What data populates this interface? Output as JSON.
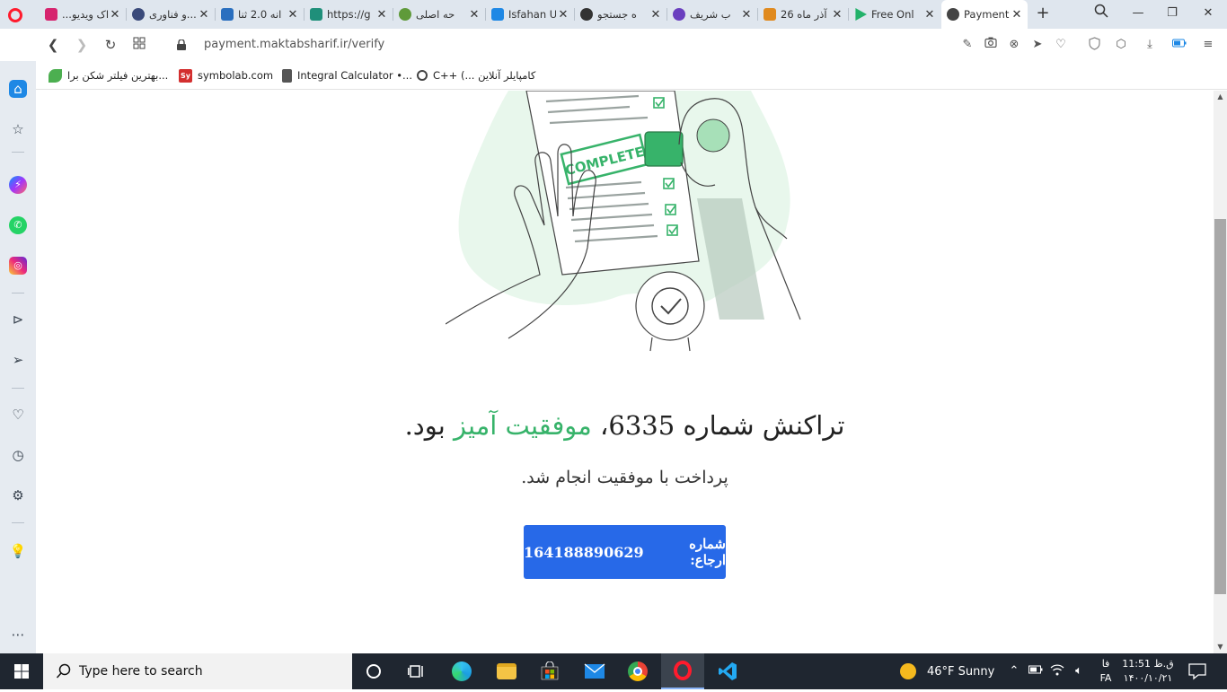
{
  "browser": {
    "tabs": [
      {
        "title": "...اک ویدیو",
        "favicon": "instagram-like-icon",
        "color": "#d6246e"
      },
      {
        "title": "و فناوری...",
        "favicon": "globe-icon",
        "color": "#3a4a7a"
      },
      {
        "title": "انه 2.0 ثنا",
        "favicon": "chart-icon",
        "color": "#2a6fbf"
      },
      {
        "title": "https://g",
        "favicon": "shield-icon",
        "color": "#1f8f7a"
      },
      {
        "title": "حه اصلی",
        "favicon": "flower-icon",
        "color": "#5f9a3a"
      },
      {
        "title": "Isfahan U",
        "favicon": "envelope-icon",
        "color": "#1e88e5"
      },
      {
        "title": "ه جستجو",
        "favicon": "globe-icon",
        "color": "#333333"
      },
      {
        "title": "ب شریف",
        "favicon": "pen-icon",
        "color": "#6a3fbf"
      },
      {
        "title": "26 آذر ماه",
        "favicon": "m-icon",
        "color": "#e08a1e"
      },
      {
        "title": "Free Onl",
        "favicon": "play-icon",
        "color": "#23b26a"
      },
      {
        "title": "Payment",
        "favicon": "globe-icon",
        "color": "#333333"
      }
    ],
    "new_tab": "+",
    "url": "payment.maktabsharif.ir/verify",
    "bookmarks": [
      {
        "label": "بهترین فیلتر شکن برا...",
        "icon": "leaf-icon",
        "color": "#4caf50"
      },
      {
        "label": "symbolab.com",
        "icon": "symbolab-icon",
        "color": "#d32f2f",
        "badge": "Sy"
      },
      {
        "label": "Integral Calculator •...",
        "icon": "file-icon",
        "color": "#555555"
      },
      {
        "label": "C++ (... کامپایلر آنلاین",
        "icon": "cpp-icon",
        "color": "#444444"
      }
    ]
  },
  "page": {
    "headline_pre": "تراکنش شماره 6335، ",
    "headline_success": "موفقیت آمیز",
    "headline_post": " بود.",
    "subtitle": "پرداخت با موفقیت انجام شد.",
    "reference_label": "شماره ارجاع:",
    "reference_number": "164188890629",
    "illustration_stamp_text": "COMPLETE",
    "accent": "#37b36a",
    "button_color": "#2769e8"
  },
  "taskbar": {
    "search_placeholder": "Type here to search",
    "weather": "46°F  Sunny",
    "language_top": "فا",
    "language_bottom": "FA",
    "time": "11:51 ق.ظ",
    "date": "۱۴۰۰/۱۰/۲۱"
  }
}
